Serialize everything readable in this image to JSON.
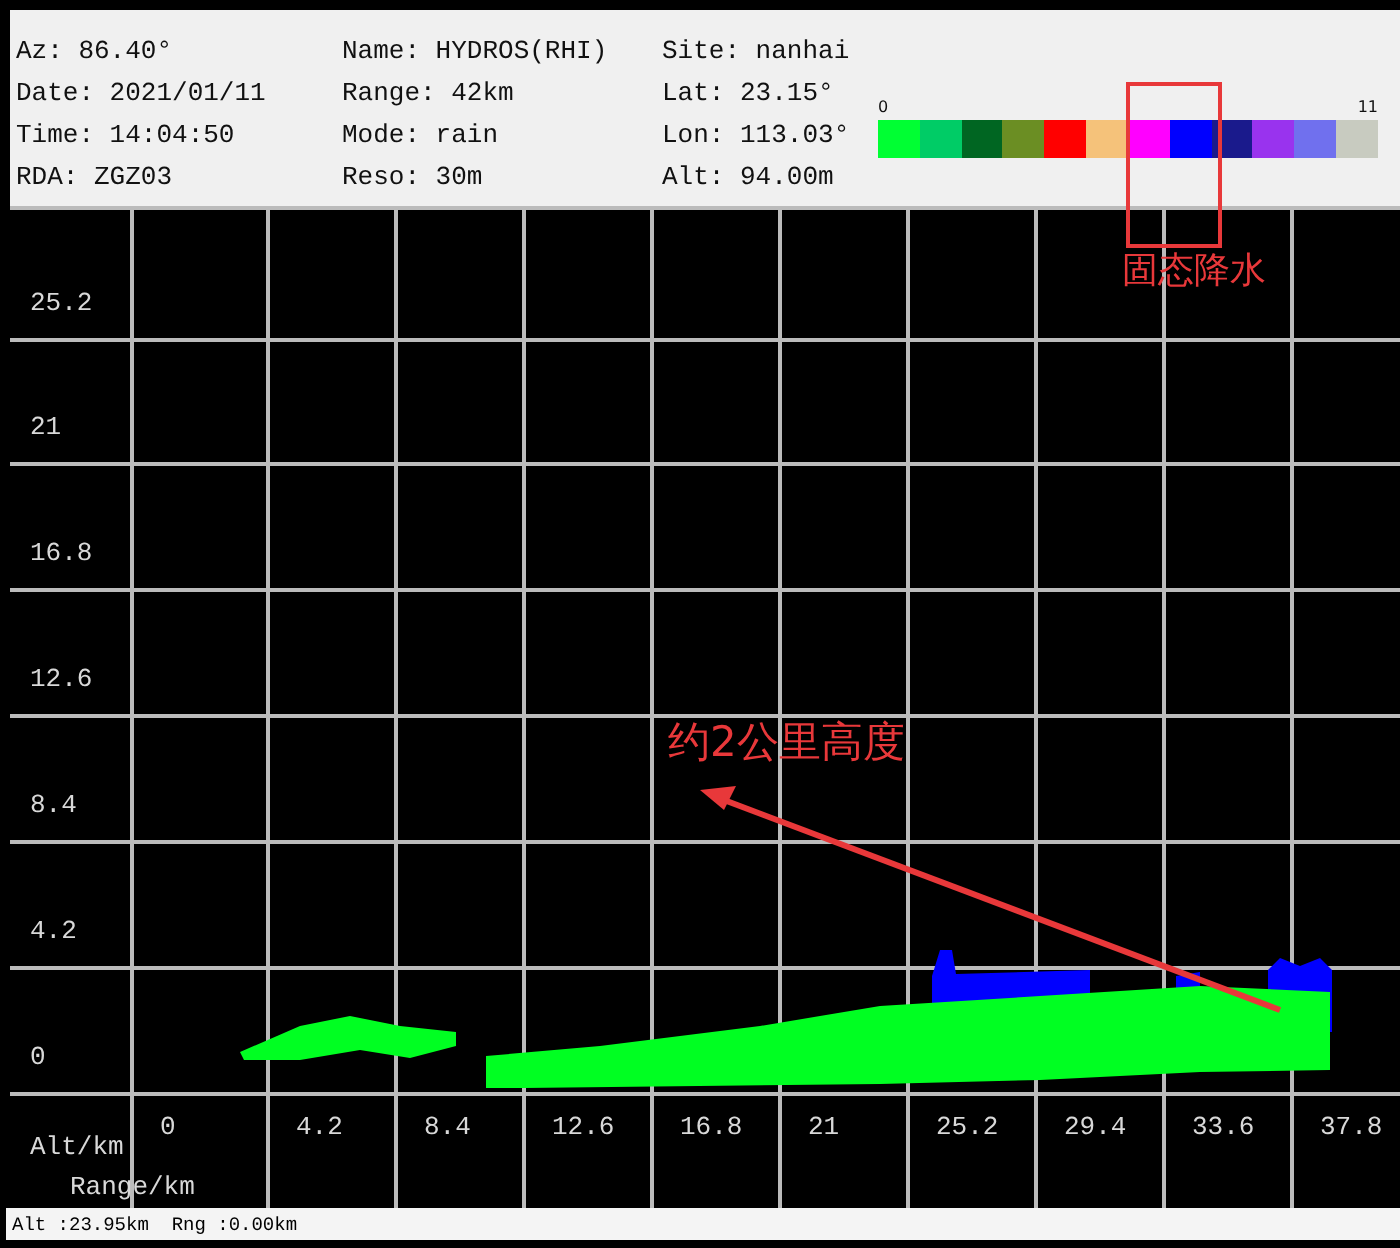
{
  "header": {
    "columns": [
      [
        "Az: 86.40°",
        "Date: 2021/01/11",
        "Time: 14:04:50",
        "RDA: ZGZ03"
      ],
      [
        "Name: HYDROS(RHI)",
        "Range: 42km",
        "Mode: rain",
        "Reso: 30m"
      ],
      [
        "Site: nanhai",
        "Lat: 23.15°",
        "Lon: 113.03°",
        "Alt: 94.00m"
      ]
    ]
  },
  "legend": {
    "min_label": "0",
    "max_label": "11",
    "colors": [
      {
        "color": "#00ff33"
      },
      {
        "color": "#00cc66"
      },
      {
        "color": "#006622"
      },
      {
        "color": "#6b8e23"
      },
      {
        "color": "#ff0000"
      },
      {
        "color": "#f5c27a"
      },
      {
        "color": "#ff00ff"
      },
      {
        "color": "#0000ff"
      },
      {
        "color": "#1a1a8c"
      },
      {
        "color": "#9933ee"
      },
      {
        "color": "#7070ee"
      },
      {
        "color": "#c8cbc0"
      }
    ]
  },
  "plot": {
    "y_ticks": [
      "25.2",
      "21",
      "16.8",
      "12.6",
      "8.4",
      "4.2",
      "0"
    ],
    "x_ticks": [
      "0",
      "4.2",
      "8.4",
      "12.6",
      "16.8",
      "21",
      "25.2",
      "29.4",
      "33.6",
      "37.8"
    ],
    "y_axis_label": "Alt/km",
    "x_axis_label": "Range/km"
  },
  "annotations": [
    {
      "kind": "box",
      "text": "固态降水"
    },
    {
      "kind": "arrow",
      "text": "约2公里高度"
    }
  ],
  "status_bar": "Alt :23.95km  Rng :0.00km"
}
